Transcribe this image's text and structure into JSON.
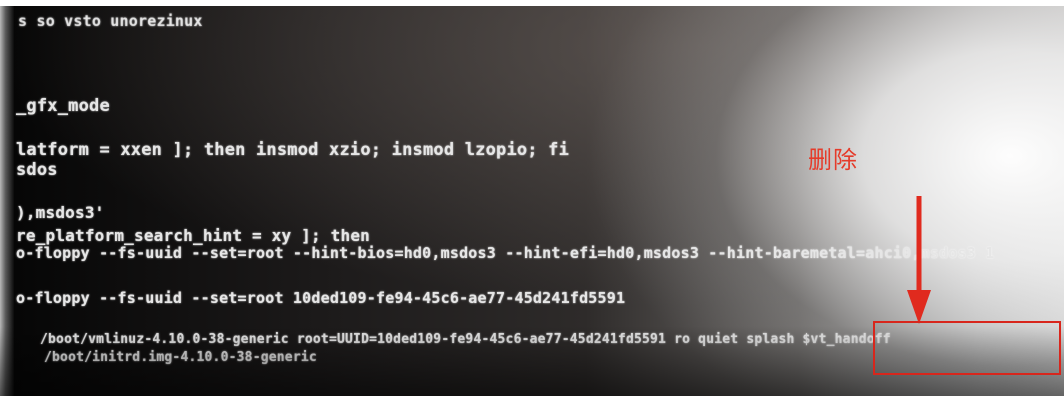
{
  "screen": {
    "lines": [
      "s so vsto unorezinux",
      "_gfx_mode",
      "latform = xxen ]; then insmod xzio; insmod lzopio; fi",
      "sdos",
      "),msdos3'",
      "re_platform_search_hint = xy ]; then",
      "o-floppy --fs-uuid --set=root --hint-bios=hd0,msdos3 --hint-efi=hd0,msdos3 --hint-baremetal=ahci0,msdos3 1",
      "o-floppy --fs-uuid --set=root 10ded109-fe94-45c6-ae77-45d241fd5591",
      "/boot/vmlinuz-4.10.0-38-generic root=UUID=10ded109-fe94-45c6-ae77-45d241fd5591 ro  quiet splash $vt_handoff",
      "/boot/initrd.img-4.10.0-38-generic"
    ]
  },
  "annotation": {
    "note": "删除",
    "color": "#e53b2a",
    "arrow_color": "#e02a1e",
    "box_color": "#d8261c"
  }
}
